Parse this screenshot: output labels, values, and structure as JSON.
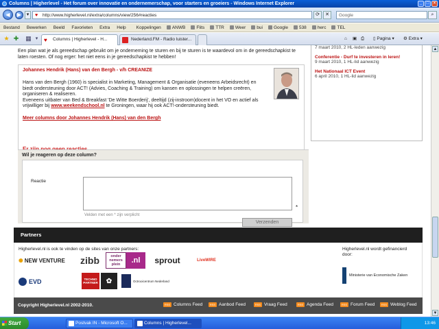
{
  "window": {
    "title": "Columns | Higherlevel - Het forum over innovatie en ondernemerschap, voor starters en groeiers - Windows Internet Explorer"
  },
  "address": {
    "url": "http://www.higherlevel.nl/extra/columns/view/256#reacties",
    "search_placeholder": "Google"
  },
  "menu": [
    "Bestand",
    "Bewerken",
    "Beeld",
    "Favorieten",
    "Extra",
    "Help"
  ],
  "links": [
    "Koppelingen",
    "ANWB",
    "Flits",
    "TTR",
    "Weer",
    "bui",
    "Google",
    "538",
    "herc",
    "TEL"
  ],
  "tabs": [
    {
      "label": "Columns | Higherlevel - H..."
    },
    {
      "label": "Nederland.FM - Radio luister..."
    }
  ],
  "toolbar_right": {
    "page": "Pagina",
    "extra": "Extra"
  },
  "sidebar": {
    "items": [
      {
        "title": "",
        "detail": "7 maart 2010, 2 HL-leden aanwezig"
      },
      {
        "title": "Conferentie - Durf te investeren in leren!",
        "detail": "9 maart 2010, 1 HL-lid aanwezig"
      },
      {
        "title": "Het Nationaal ICT Event",
        "detail": "6 april 2010, 1 HL-lid aanwezig"
      }
    ]
  },
  "article": {
    "intro": "Een plan wat je als gereedschap gebruikt om je onderneming te sturen en bij te sturen is te waardevol om in de gereedschapkist te laten roesten. Of nog erger: het niet eens in je gereedschapkist te hebben!",
    "author_title": "Johannes Hendrik (Hans) van den Bergh - v/h CREANIZE",
    "bio_p1": "Hans van den Bergh (1960) is specialist in Marketing, Management & Organisatie (eveneens Arbeidsrecht) en biedt ondersteuning door ACT! (Advies, Coaching & Training) om kansen en oplossingen te helpen creëren, organiseren & realiseren.",
    "bio_p2_a": "Eveneens uitbater van Bed & Breakfast 'De Witte Boerderij', deeltijd (zij-instroom)docent in het VO en actief als vrijwilliger bij ",
    "bio_link": "www.weekendschool.nl",
    "bio_p2_b": " te Groningen, waar hij ook ACT!-ondersteuning biedt.",
    "more_link": "Meer columns door Johannes Hendrik (Hans) van den Bergh",
    "no_reactions": "Er zijn nog geen reacties"
  },
  "react_form": {
    "title": "Wil je reageren op deze column?",
    "label": "Reactie",
    "star": "*",
    "hint": "Velden met een * zijn verplicht",
    "submit": "Verzenden"
  },
  "partners": {
    "title": "Partners",
    "intro": "Higherlevel.nl is ook te vinden op de sites van onze partners:",
    "funding": "Higherlevel.nl wordt gefinancierd door:",
    "logos": [
      "NEW VENTURE",
      "zibb",
      "onder nemers plein",
      ".nl",
      "sprout",
      "LiveWIRE",
      "EVD",
      "TECHNO PARTNER",
      "Octrooicentrum Nederland",
      "Ministerie van Economische Zaken"
    ]
  },
  "footer": {
    "copyright": "Copyright Higherlevel.nl 2002-2010.",
    "rss_badge": "RSS",
    "feeds": [
      "Columns Feed",
      "Aanbod Feed",
      "Vraag Feed",
      "Agenda Feed",
      "Forum Feed",
      "Weblog Feed"
    ]
  },
  "taskbar": {
    "start": "Start",
    "tasks": [
      "Postvak IN - Microsoft O...",
      "Columns | Higherlevel..."
    ],
    "clock": "13:46"
  },
  "colors": {
    "accent": "#bb1111",
    "ie_blue": "#0a5fd8",
    "footer_bg": "#4a4a4a",
    "partners_bar": "#1f1f1f"
  }
}
